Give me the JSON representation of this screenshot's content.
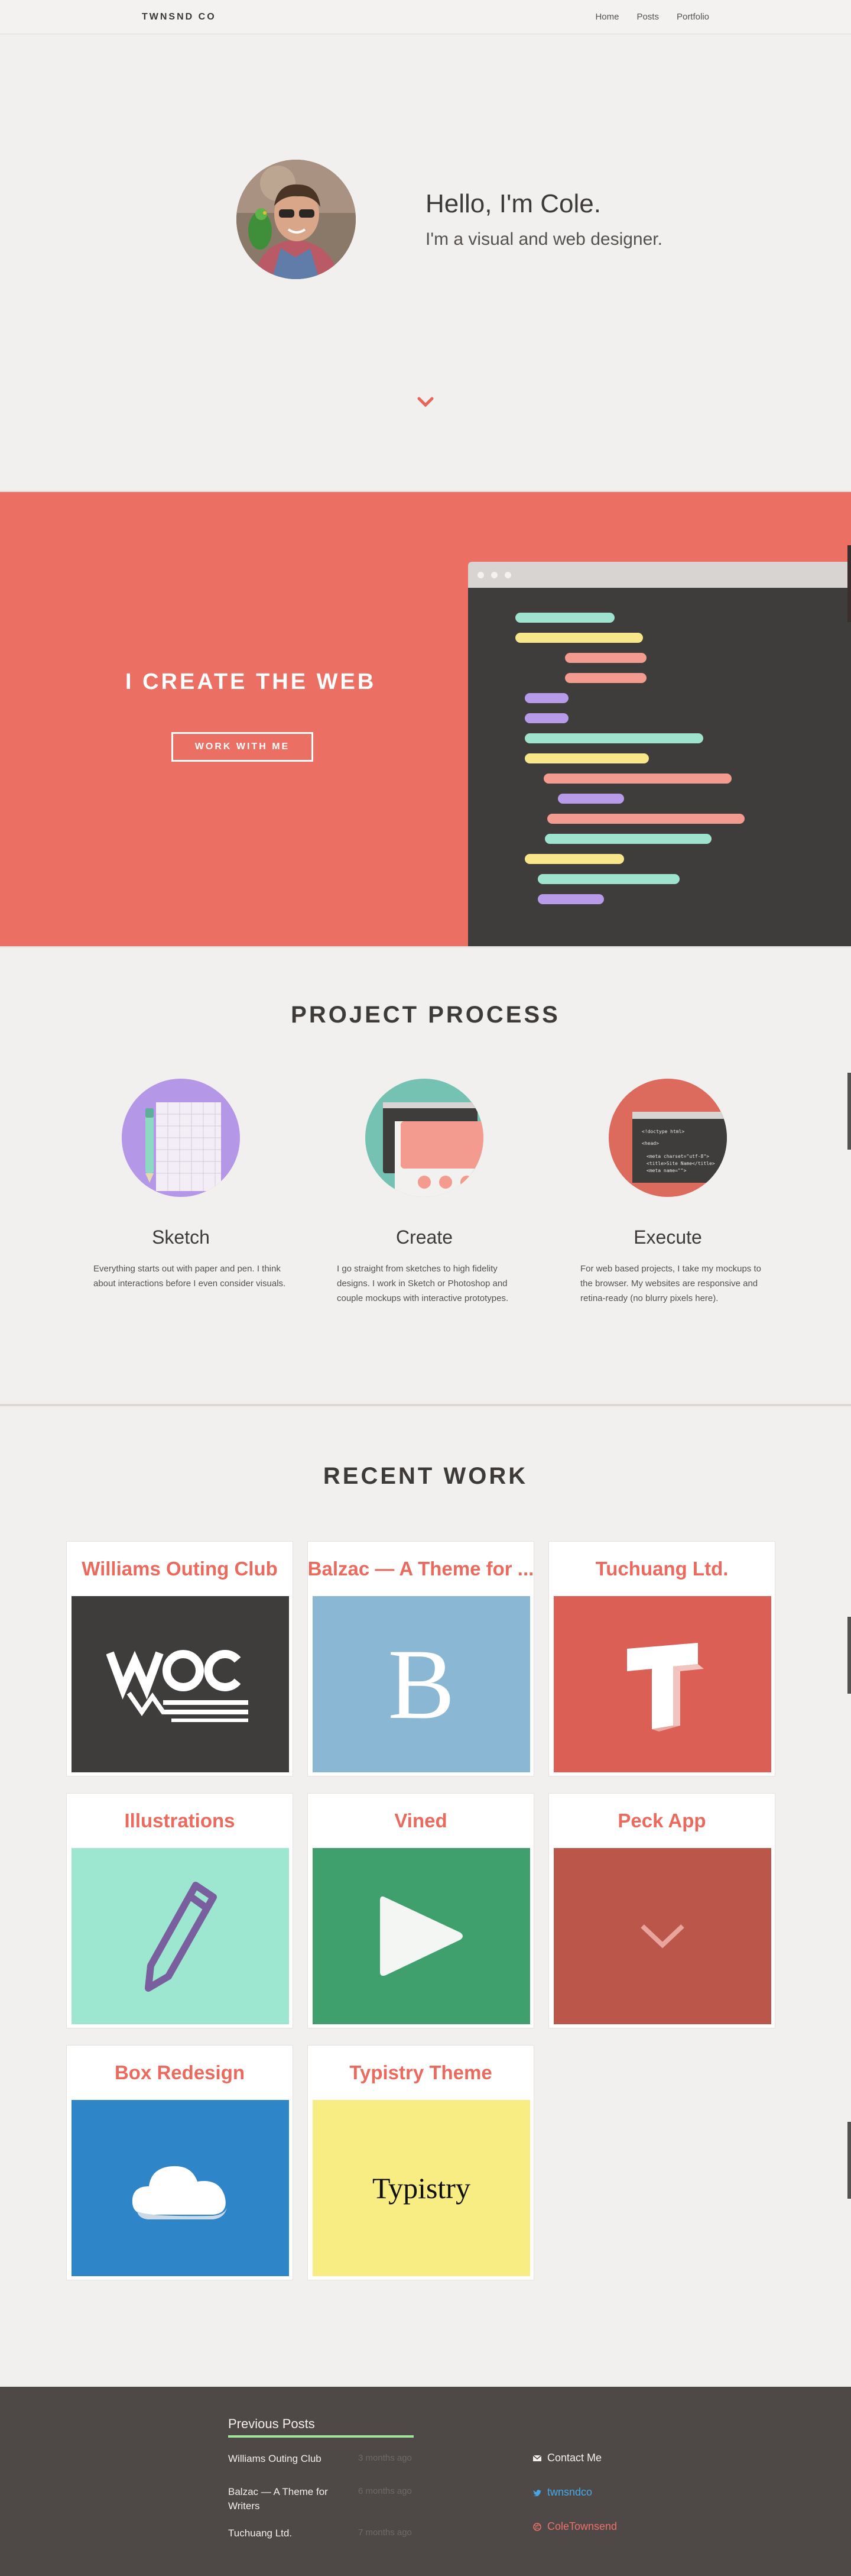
{
  "nav": {
    "brand": "TWNSND CO",
    "links": [
      "Home",
      "Posts",
      "Portfolio"
    ]
  },
  "hero": {
    "title": "Hello, I'm Cole.",
    "subtitle": "I'm a visual and web designer."
  },
  "create": {
    "title": "I CREATE THE WEB",
    "button": "WORK WITH ME"
  },
  "process": {
    "title": "PROJECT PROCESS",
    "steps": [
      {
        "name": "Sketch",
        "desc": "Everything starts out with paper and pen. I think about interactions before I even consider visuals."
      },
      {
        "name": "Create",
        "desc": "I go straight from sketches to high fidelity designs. I work in Sketch or Photoshop and couple mockups with interactive prototypes."
      },
      {
        "name": "Execute",
        "desc": "For web based projects, I take my mockups to the browser. My websites are responsive and retina-ready (no blurry pixels here)."
      }
    ],
    "code_snippet": [
      "<!doctype html>",
      "<head>",
      "<meta charset=\"utf-8\">",
      "<title>Site Name</title>",
      "<meta name=\"\">"
    ]
  },
  "work": {
    "title": "RECENT WORK",
    "items": [
      {
        "title": "Williams Outing Club",
        "thumb": "WOC",
        "color": "#3f3d3c"
      },
      {
        "title": "Balzac — A Theme for ...",
        "thumb": "B",
        "color": "#8ab8d4"
      },
      {
        "title": "Tuchuang Ltd.",
        "thumb": "T",
        "color": "#dc5f56"
      },
      {
        "title": "Illustrations",
        "thumb": "pencil-icon",
        "color": "#9de6d0"
      },
      {
        "title": "Vined",
        "thumb": "play-icon",
        "color": "#3fa06e"
      },
      {
        "title": "Peck App",
        "thumb": "chevron-icon",
        "color": "#ba574a"
      },
      {
        "title": "Box Redesign",
        "thumb": "cloud-icon",
        "color": "#2e86c8"
      },
      {
        "title": "Typistry Theme",
        "thumb": "Typistry",
        "color": "#f8ed82"
      }
    ]
  },
  "footer": {
    "heading": "Previous Posts",
    "posts": [
      {
        "title": "Williams Outing Club",
        "time": "3 months ago"
      },
      {
        "title": "Balzac — A Theme for Writers",
        "time": "6 months ago"
      },
      {
        "title": "Tuchuang Ltd.",
        "time": "7 months ago"
      }
    ],
    "contacts": [
      {
        "label": "Contact Me",
        "icon": "mail-icon",
        "color": "#f2efec"
      },
      {
        "label": "twnsndco",
        "icon": "twitter-icon",
        "color": "#45a8e6"
      },
      {
        "label": "ColeTownsend",
        "icon": "dribbble-icon",
        "color": "#e9716a"
      }
    ]
  }
}
